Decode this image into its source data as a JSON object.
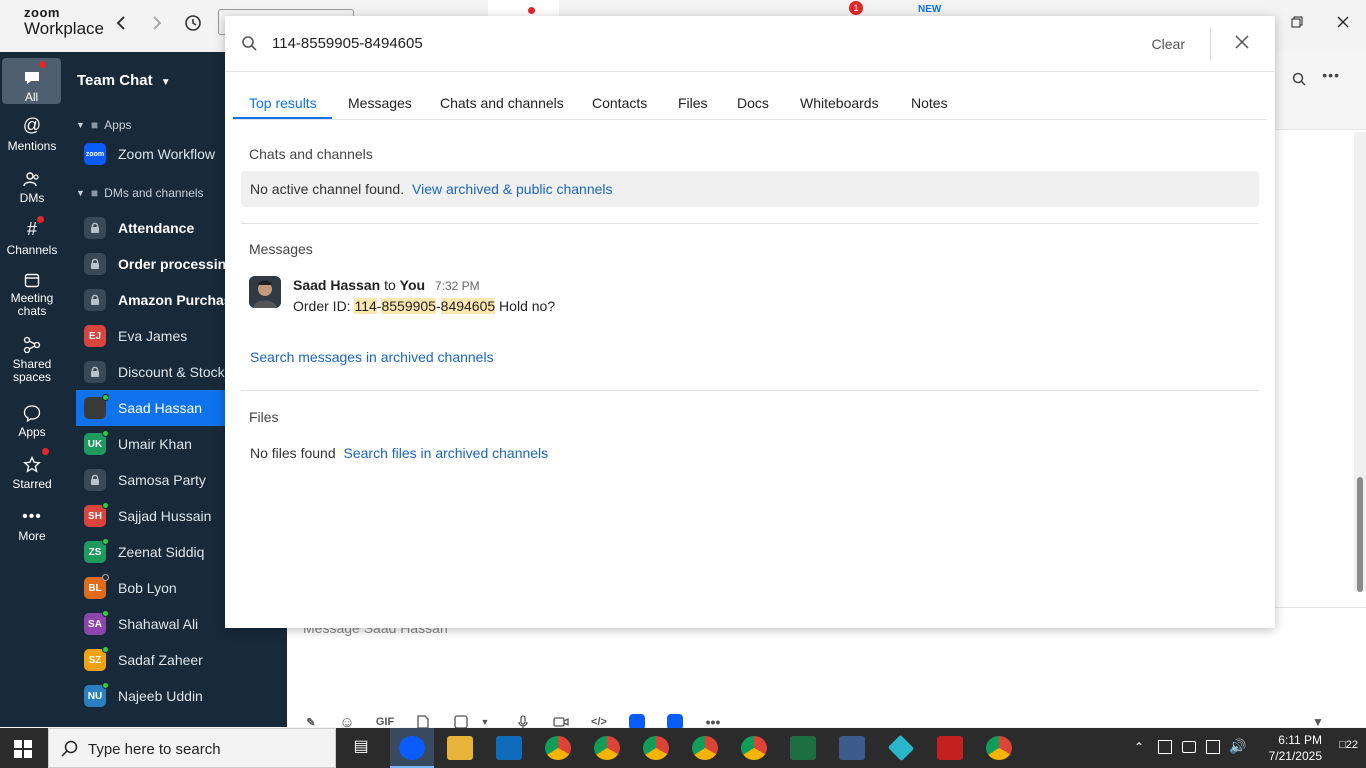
{
  "app": {
    "brand_line1": "zoom",
    "brand_line2": "Workplace",
    "badge_count": "1",
    "new_badge": "NEW"
  },
  "rail": [
    {
      "label": "All",
      "icon": "chat-bubble-icon"
    },
    {
      "label": "Mentions",
      "icon": "at-icon"
    },
    {
      "label": "DMs",
      "icon": "people-icon"
    },
    {
      "label": "Channels",
      "icon": "hash-icon"
    },
    {
      "label": "Meeting chats",
      "icon": "calendar-icon"
    },
    {
      "label": "Shared spaces",
      "icon": "share-icon"
    },
    {
      "label": "Apps",
      "icon": "apps-icon"
    },
    {
      "label": "Starred",
      "icon": "star-icon"
    },
    {
      "label": "More",
      "icon": "more-icon"
    }
  ],
  "sidebar": {
    "title": "Team Chat",
    "section_apps": "Apps",
    "section_dms": "DMs and channels",
    "app_item": {
      "label": "Zoom Workflow",
      "avatar": "zoom"
    },
    "items": [
      {
        "label": "Attendance",
        "type": "lock"
      },
      {
        "label": "Order processing",
        "type": "lock"
      },
      {
        "label": "Amazon Purchasing",
        "type": "lock"
      },
      {
        "label": "Eva James",
        "initials": "EJ",
        "color": "#d9453b",
        "status": "none"
      },
      {
        "label": "Discount & Stock Reports",
        "type": "lock"
      },
      {
        "label": "Saad Hassan",
        "initials": "",
        "color": "#3a3a3a",
        "status": "online"
      },
      {
        "label": "Umair Khan",
        "initials": "UK",
        "color": "#1d9b5e",
        "status": "online"
      },
      {
        "label": "Samosa Party",
        "type": "lock"
      },
      {
        "label": "Sajjad Hussain",
        "initials": "SH",
        "color": "#d9453b",
        "status": "online"
      },
      {
        "label": "Zeenat Siddiq",
        "initials": "ZS",
        "color": "#1d9b5e",
        "status": "online"
      },
      {
        "label": "Bob Lyon",
        "initials": "BL",
        "color": "#e06b1a",
        "status": "offline"
      },
      {
        "label": "Shahawal Ali",
        "initials": "SA",
        "color": "#8e44ad",
        "status": "online"
      },
      {
        "label": "Sadaf Zaheer",
        "initials": "SZ",
        "color": "#f0a20f",
        "status": "online"
      },
      {
        "label": "Najeeb Uddin",
        "initials": "NU",
        "color": "#2a7fc1",
        "status": "online"
      }
    ]
  },
  "composer": {
    "placeholder": "Message Saad Hassan",
    "gif": "GIF"
  },
  "search": {
    "query": "114-8559905-8494605",
    "clear_label": "Clear",
    "tabs": [
      "Top results",
      "Messages",
      "Chats and channels",
      "Contacts",
      "Files",
      "Docs",
      "Whiteboards",
      "Notes"
    ],
    "chats_section_title": "Chats and channels",
    "chats_empty": "No active channel found.",
    "chats_link": "View archived & public channels",
    "messages_section_title": "Messages",
    "message": {
      "sender": "Saad Hassan",
      "to_word": "to",
      "recipient": "You",
      "time": "7:32 PM",
      "prefix": "Order ID: ",
      "hl1": "114",
      "dash1": "-",
      "hl2": "8559905",
      "dash2": "-",
      "hl3": "8494605",
      "suffix": " Hold no?"
    },
    "archived_messages_link": "Search messages in archived channels",
    "files_section_title": "Files",
    "files_empty": "No files found",
    "files_link": "Search files in archived channels"
  },
  "taskbar": {
    "search_placeholder": "Type here to search",
    "time": "6:11 PM",
    "date": "7/21/2025",
    "notifications": "22"
  },
  "colors": {
    "accent": "#0e72ed",
    "link": "#1a66c0",
    "highlight": "#fde7b0",
    "rail_bg": "#18293a"
  }
}
